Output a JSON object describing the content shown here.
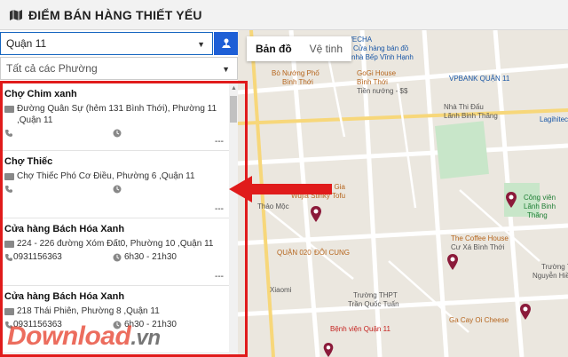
{
  "header": {
    "title": "ĐIỂM BÁN HÀNG THIẾT YẾU"
  },
  "filters": {
    "district": "Quận 11",
    "ward": "Tất cả các Phường"
  },
  "map_tabs": [
    "Bản đồ",
    "Vệ tinh"
  ],
  "stores": [
    {
      "name": "Chợ Chim xanh",
      "address": "Đường Quân Sự (hẻm 131 Bình Thới), Phường 11 ,Quận 11",
      "phone": "",
      "hours": "",
      "more": "---"
    },
    {
      "name": "Chợ Thiếc",
      "address": "Chợ Thiếc Phó Cơ Điều, Phường 6 ,Quận 11",
      "phone": "",
      "hours": "",
      "more": "---"
    },
    {
      "name": "Cửa hàng Bách Hóa Xanh",
      "address": "224 - 226 đường Xóm Đất0, Phường 10 ,Quận 11",
      "phone": "0931156363",
      "hours": "6h30 - 21h30",
      "more": "---"
    },
    {
      "name": "Cửa hàng Bách Hóa Xanh",
      "address": "218 Thái Phiên, Phường 8 ,Quận 11",
      "phone": "0931156363",
      "hours": "6h30 - 21h30",
      "more": ""
    }
  ],
  "map_labels": [
    "ra Xe WECHA",
    "Cửa hàng bán đồ",
    "nhà Bếp Vĩnh Hạnh",
    "Bò Nướng Phố",
    "Bình Thới",
    "GoGi House",
    "Bình Thới",
    "Tiền nướng - $$",
    "VPBANK QUẬN 11",
    "Nhà Thi Đấu",
    "Lãnh Binh Thăng",
    "Công viên",
    "Lãnh Binh",
    "Thăng",
    "Thùi Ngói Gia",
    "Wujia Stinky Tofu",
    "Thảo Mộc",
    "QUẬN 020",
    "ĐÔI CUNG",
    "The Coffee House",
    "Cư Xá Bình Thới",
    "Trường THPT",
    "Nguyễn Hiền",
    "Trường THPT",
    "Trần Quốc Tuấn",
    "Ga Cay Oi Cheese",
    "Bệnh viện Quận 11",
    "Lagihitech",
    "Xiaomi"
  ],
  "watermark": {
    "part1": "Download",
    "part2": ".vn"
  },
  "colors": {
    "accent": "#1e5fd6",
    "highlight": "#e01b1b"
  }
}
